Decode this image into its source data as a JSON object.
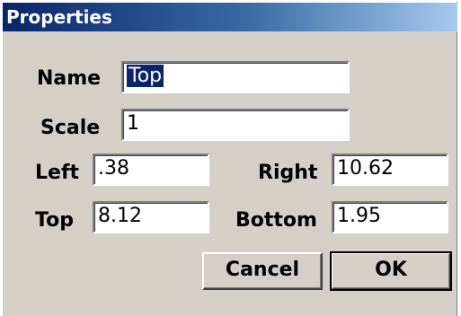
{
  "dialog": {
    "title": "Properties"
  },
  "fields": {
    "name_label": "Name",
    "name_value": "Top",
    "scale_label": "Scale",
    "scale_value": "1",
    "left_label": "Left",
    "left_value": ".38",
    "right_label": "Right",
    "right_value": "10.62",
    "top_label": "Top",
    "top_value": "8.12",
    "bottom_label": "Bottom",
    "bottom_value": "1.95"
  },
  "buttons": {
    "cancel_label": "Cancel",
    "ok_label": "OK"
  },
  "colors": {
    "title_bar": "#0a246a",
    "selection": "#0a246a",
    "dialog_background": "#d4d0c8"
  }
}
